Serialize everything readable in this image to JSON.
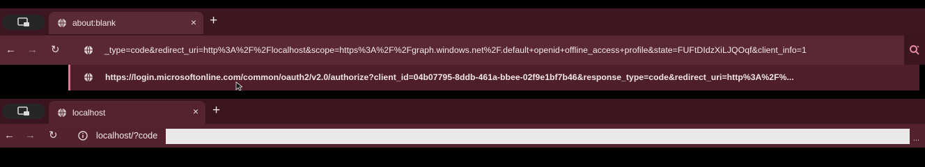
{
  "window1": {
    "tab_title": "about:blank",
    "tab_close": "×",
    "new_tab": "+",
    "address_text": "_type=code&redirect_uri=http%3A%2F%2Flocalhost&scope=https%3A%2F%2Fgraph.windows.net%2F.default+openid+offline_access+profile&state=FUFtDIdzXiLJQOqf&client_info=1",
    "suggestion": "https://login.microsoftonline.com/common/oauth2/v2.0/authorize?client_id=04b07795-8ddb-461a-bbee-02f9e1bf7b46&response_type=code&redirect_uri=http%3A%2F%..."
  },
  "window2": {
    "tab_title": "localhost",
    "tab_close": "×",
    "new_tab": "+",
    "address_text": "localhost/?code",
    "ellipsis": "..."
  },
  "icons": {
    "back": "←",
    "forward": "→",
    "reload": "↻"
  },
  "colors": {
    "tabbar": "#3c1722",
    "toolbar": "#5a2835",
    "accent": "#d87a8f"
  }
}
